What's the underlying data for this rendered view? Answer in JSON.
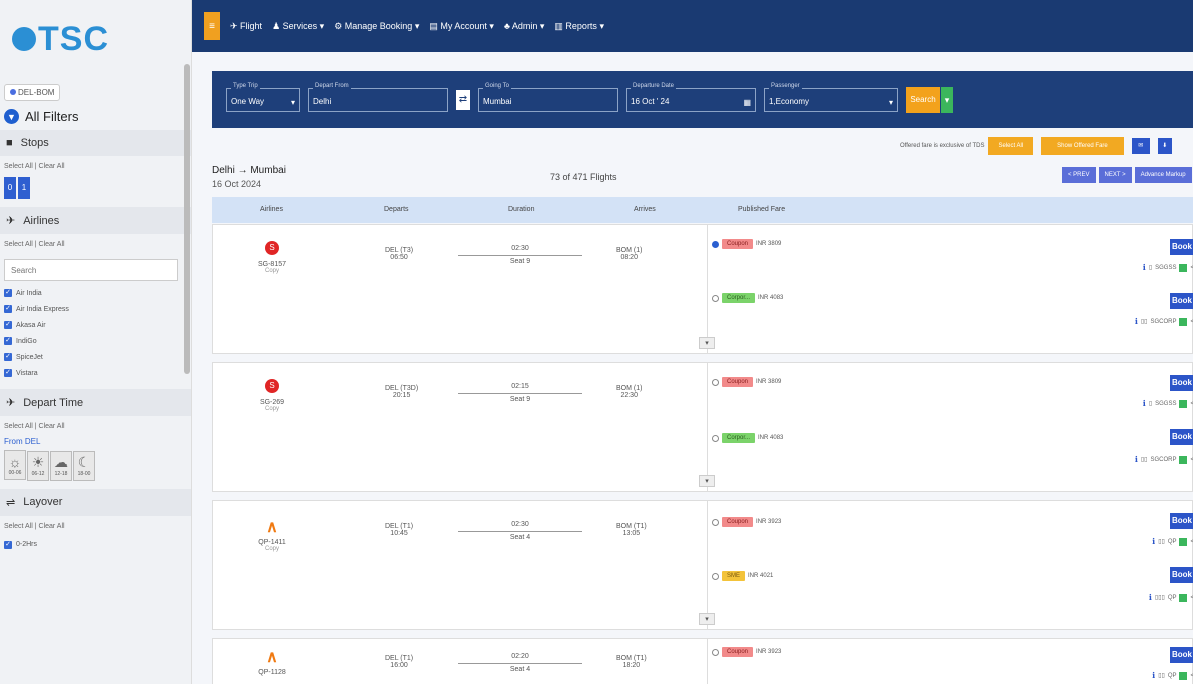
{
  "brand": {
    "logo_text": "TSC"
  },
  "sidebar": {
    "route_chip": "DEL-BOM",
    "all_filters": "All Filters",
    "stops": {
      "title": "Stops",
      "select_all": "Select All",
      "clear_all": "Clear All",
      "options": [
        "0",
        "1"
      ]
    },
    "airlines": {
      "title": "Airlines",
      "select_all": "Select All",
      "clear_all": "Clear All",
      "search_placeholder": "Search",
      "items": [
        "Air India",
        "Air India Express",
        "Akasa Air",
        "IndiGo",
        "SpiceJet",
        "Vistara"
      ]
    },
    "depart_time": {
      "title": "Depart Time",
      "select_all": "Select All",
      "clear_all": "Clear All",
      "from_label": "From DEL",
      "slots": [
        "00-06",
        "06-12",
        "12-18",
        "18-00"
      ]
    },
    "layover": {
      "title": "Layover",
      "select_all": "Select All",
      "clear_all": "Clear All",
      "first_item": "0-2Hrs"
    }
  },
  "topnav": {
    "items": [
      "Flight",
      "Services",
      "Manage Booking",
      "My Account",
      "Admin",
      "Reports"
    ]
  },
  "search": {
    "type_trip": {
      "label": "Type Trip",
      "value": "One Way"
    },
    "from": {
      "label": "Depart From",
      "value": "Delhi"
    },
    "to": {
      "label": "Going To",
      "value": "Mumbai"
    },
    "date": {
      "label": "Departure Date",
      "value": "16 Oct ' 24"
    },
    "passenger": {
      "label": "Passenger",
      "value": "1,Economy"
    },
    "search_btn": "Search"
  },
  "info": {
    "note": "Offered fare is exclusive of TDS",
    "select_all_btn": "Select All",
    "show_offered_btn": "Show Offered Fare"
  },
  "results": {
    "route": "Delhi → Mumbai",
    "date": "16 Oct 2024",
    "count": "73 of 471 Flights",
    "prev": "< PREV",
    "next": "NEXT >",
    "advance": "Advance Markup",
    "columns": [
      "Airlines",
      "Departs",
      "Duration",
      "Arrives",
      "Published Fare"
    ],
    "book_label": "Book",
    "copy_label": "Copy"
  },
  "flights": [
    {
      "code": "SG-8157",
      "dep_airport": "DEL (T3)",
      "dep_time": "06:50",
      "duration": "02:30",
      "seats": "Seat 9",
      "arr_airport": "BOM (1)",
      "arr_time": "08:20",
      "fare1": {
        "badge": "Coupon",
        "price": "INR 3809",
        "code": "SGGSS"
      },
      "fare2": {
        "badge": "Corpor...",
        "price": "INR 4083",
        "code": "SGCORP"
      }
    },
    {
      "code": "SG-269",
      "dep_airport": "DEL (T3D)",
      "dep_time": "20:15",
      "duration": "02:15",
      "seats": "Seat 9",
      "arr_airport": "BOM (1)",
      "arr_time": "22:30",
      "fare1": {
        "badge": "Coupon",
        "price": "INR 3809",
        "code": "SGGSS"
      },
      "fare2": {
        "badge": "Corpor...",
        "price": "INR 4083",
        "code": "SGCORP"
      }
    },
    {
      "code": "QP-1411",
      "dep_airport": "DEL (T1)",
      "dep_time": "10:45",
      "duration": "02:30",
      "seats": "Seat 4",
      "arr_airport": "BOM (T1)",
      "arr_time": "13:05",
      "fare1": {
        "badge": "Coupon",
        "price": "INR 3923",
        "code": "QP"
      },
      "fare2": {
        "badge": "SME",
        "price": "INR 4021",
        "code": "QP"
      }
    },
    {
      "code": "QP-1128",
      "dep_airport": "DEL (T1)",
      "dep_time": "16:00",
      "duration": "02:20",
      "seats": "Seat 4",
      "arr_airport": "BOM (T1)",
      "arr_time": "18:20",
      "fare1": {
        "badge": "Coupon",
        "price": "INR 3923",
        "code": "QP"
      }
    }
  ]
}
